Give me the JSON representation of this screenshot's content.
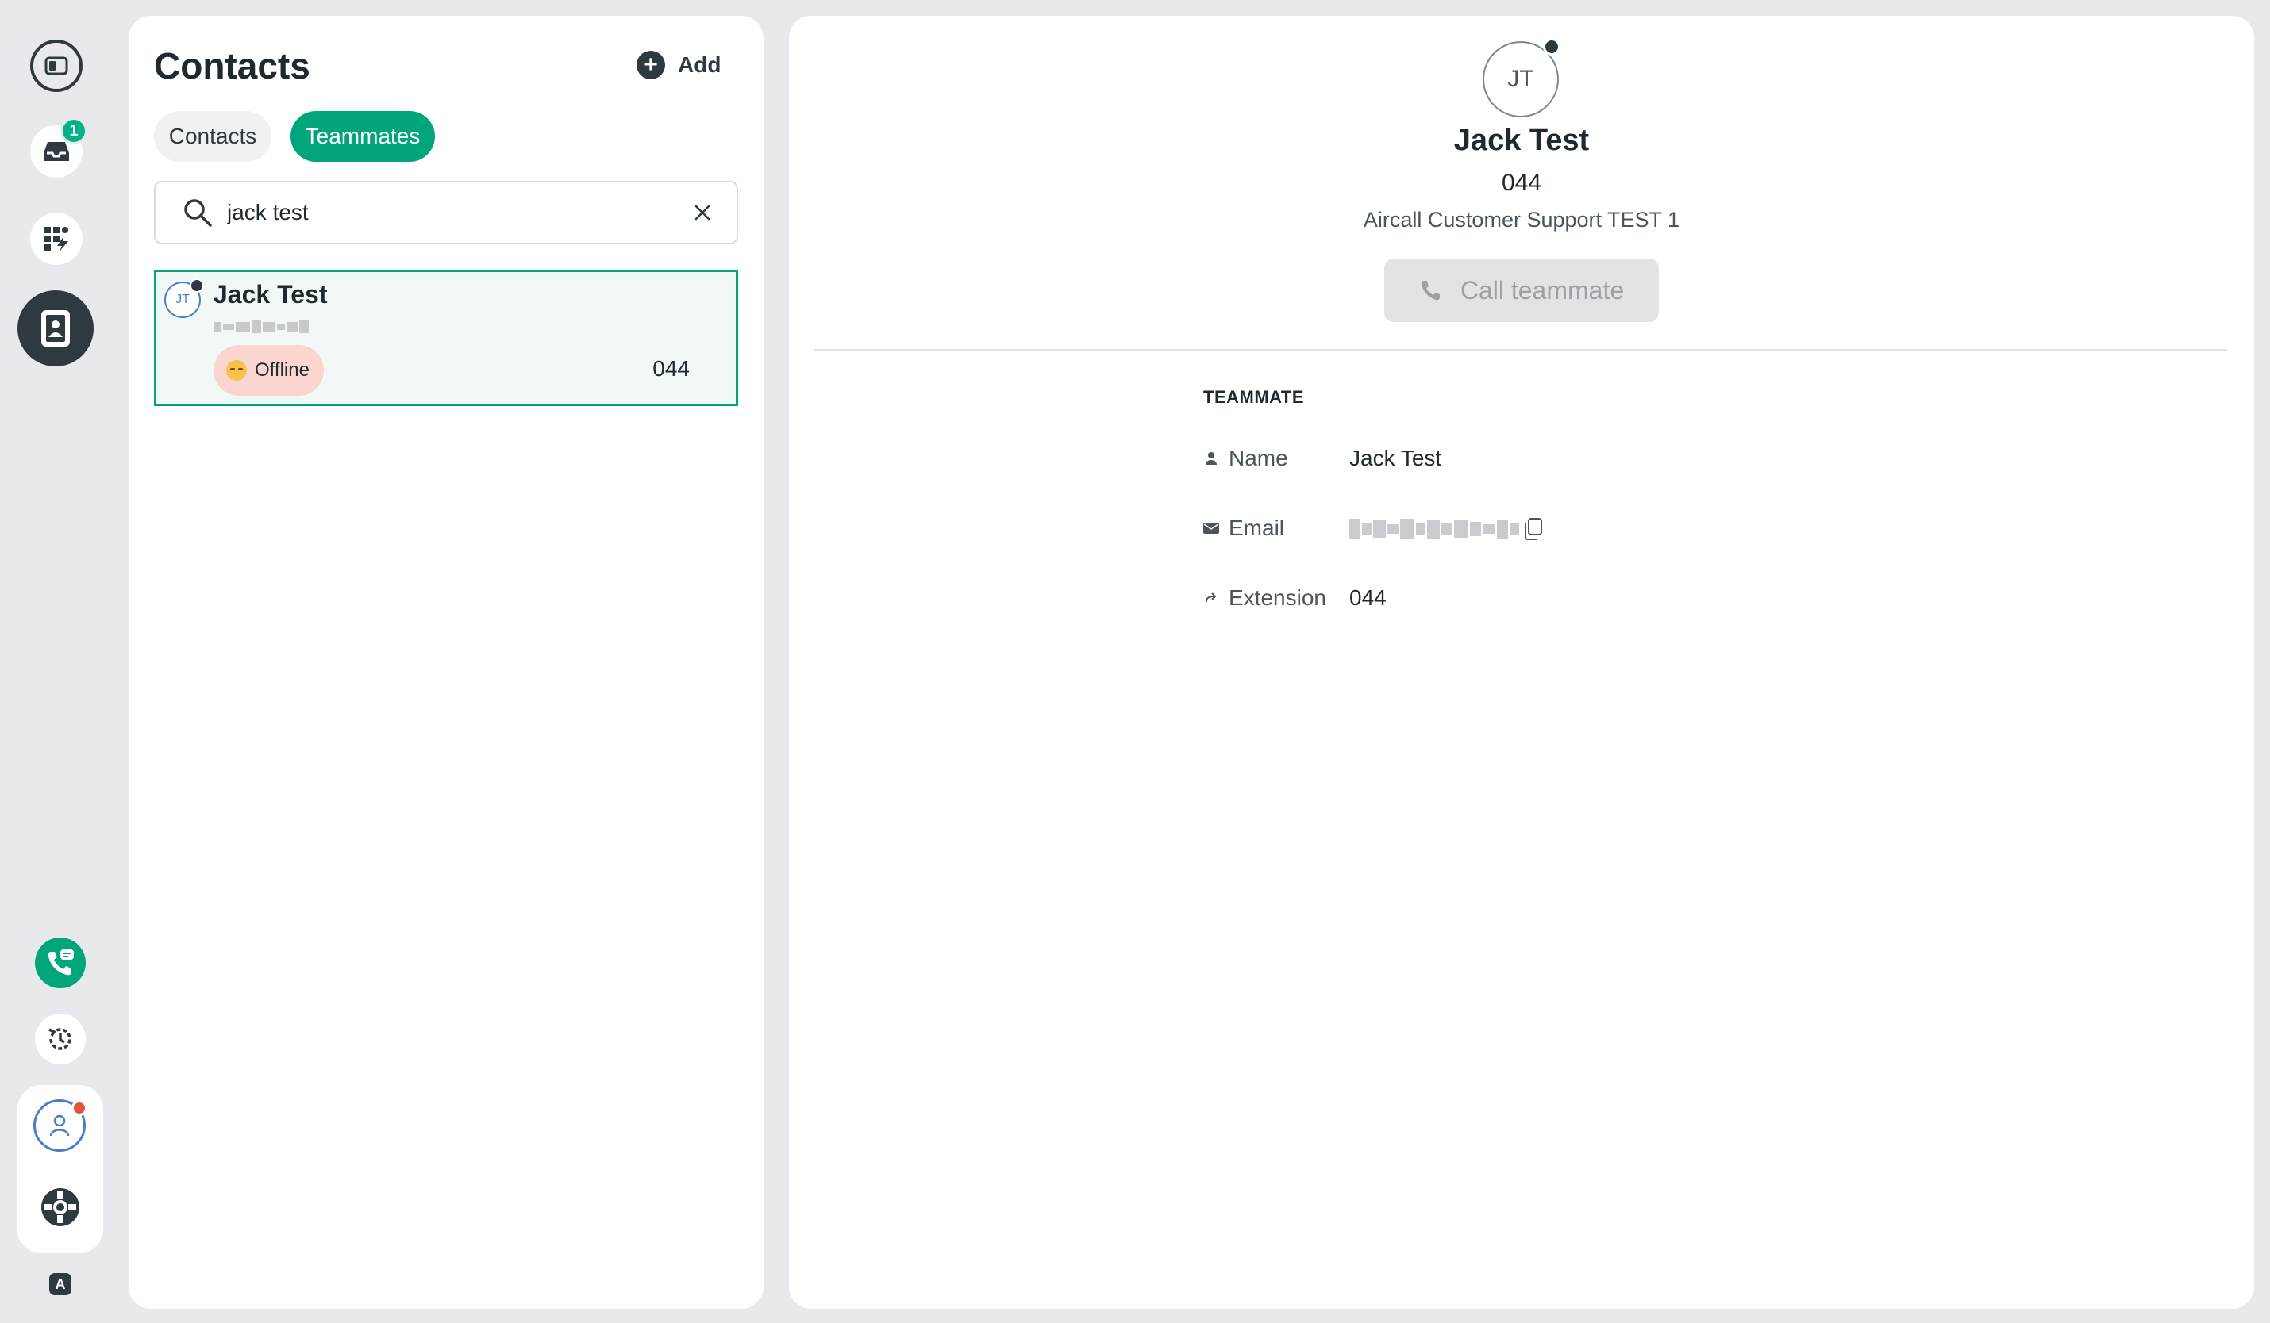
{
  "rail": {
    "inbox_badge": "1",
    "logo_letter": "A",
    "icons": [
      "sidebar-toggle-icon",
      "inbox-icon",
      "apps-icon",
      "contacts-icon",
      "dialer-icon",
      "history-icon",
      "profile-icon",
      "help-icon"
    ]
  },
  "contacts_panel": {
    "title": "Contacts",
    "add_label": "Add",
    "tabs": [
      {
        "label": "Contacts",
        "active": false
      },
      {
        "label": "Teammates",
        "active": true
      }
    ],
    "search": {
      "value": "jack test",
      "placeholder": ""
    },
    "results": [
      {
        "initials": "JT",
        "name": "Jack Test",
        "status": "Offline",
        "extension": "044"
      }
    ]
  },
  "detail": {
    "initials": "JT",
    "name": "Jack Test",
    "extension": "044",
    "company": "Aircall Customer Support TEST 1",
    "call_button": "Call teammate",
    "section_title": "TEAMMATE",
    "fields": {
      "name_label": "Name",
      "name_value": "Jack Test",
      "email_label": "Email",
      "extension_label": "Extension",
      "extension_value": "044"
    }
  },
  "colors": {
    "accent": "#00a67a",
    "dark": "#2f3a40",
    "background": "#e8e9ec",
    "offline_badge": "#fbd5cf",
    "notification": "#e5533d"
  }
}
